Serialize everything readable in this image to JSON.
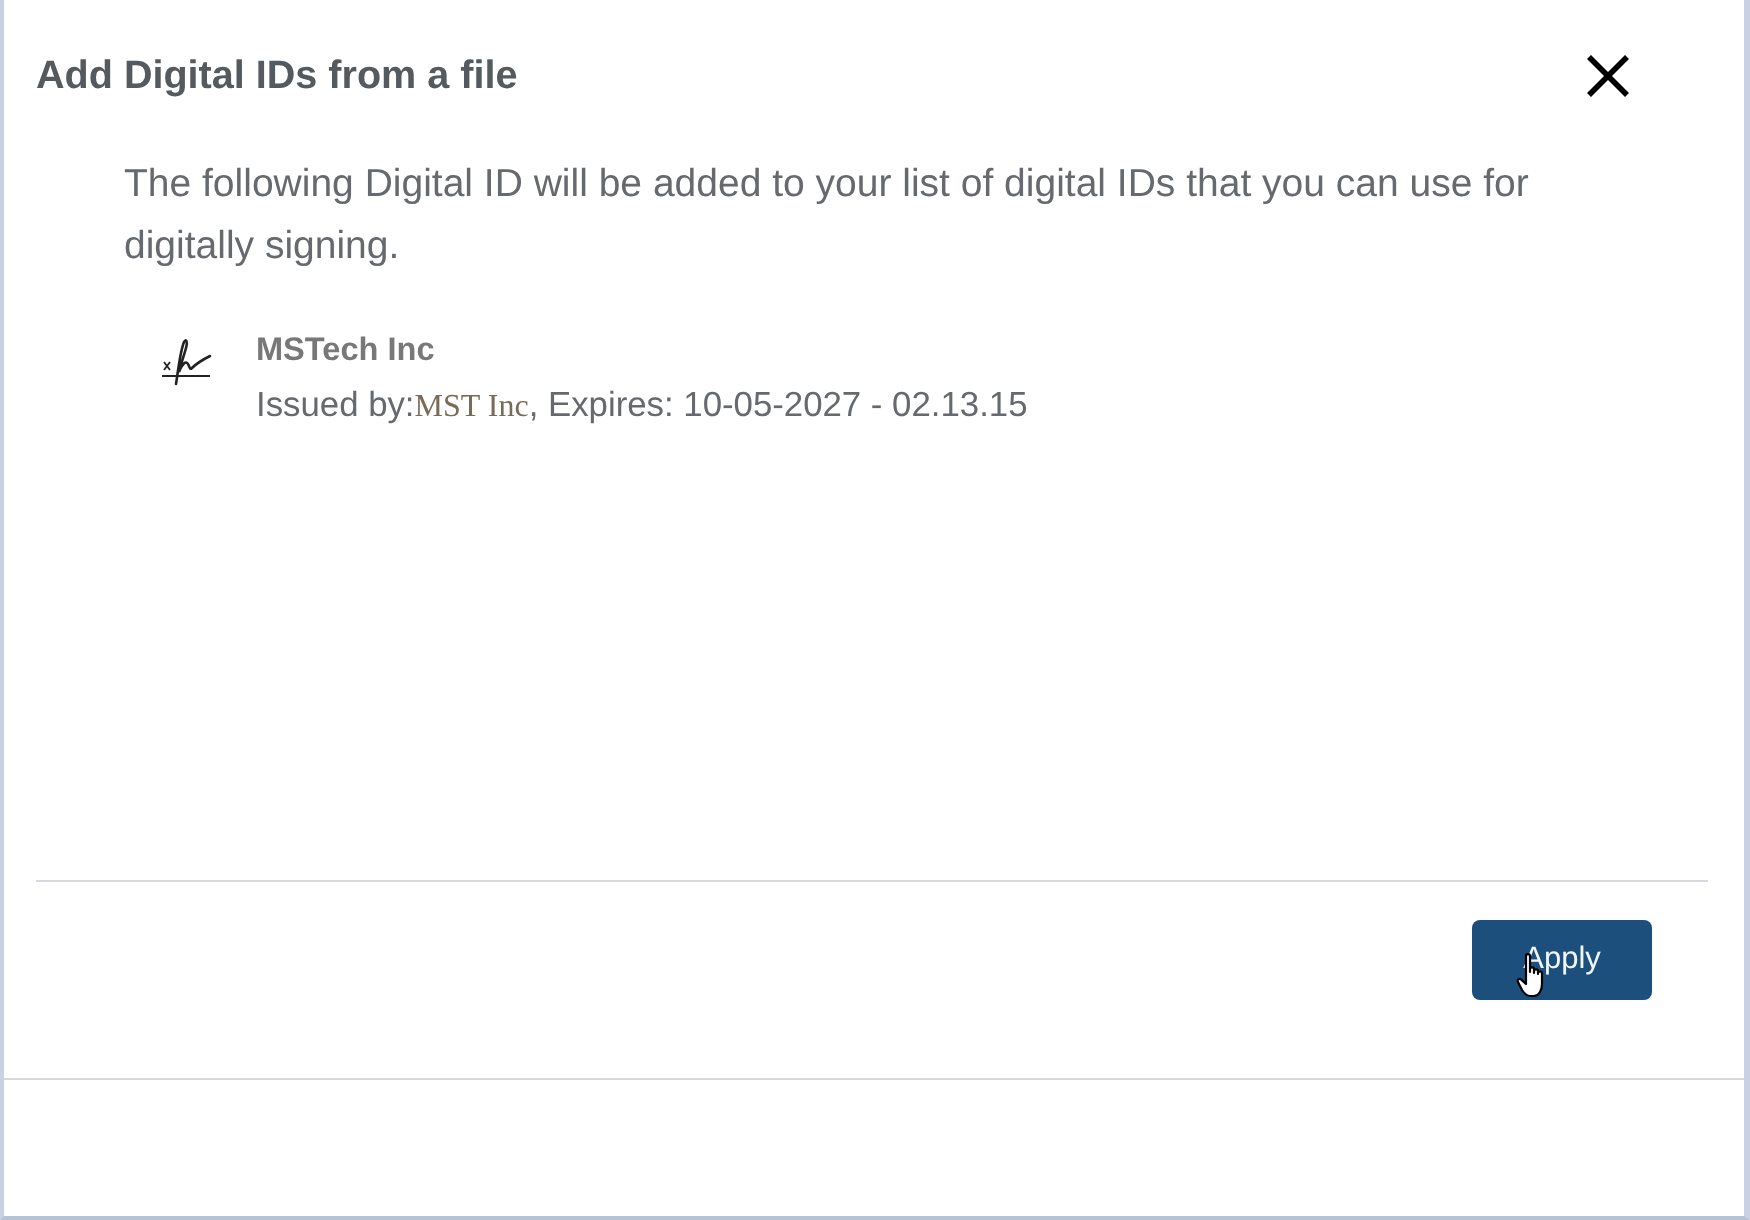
{
  "dialog": {
    "title": "Add Digital IDs from a file",
    "message": "The following Digital ID will be added to your list of digital IDs that you can use for digitally signing."
  },
  "digital_id": {
    "name": "MSTech Inc",
    "issued_by_label": "Issued by:",
    "issuer": "MST Inc",
    "expiry": ", Expires: 10-05-2027 - 02.13.15"
  },
  "buttons": [
    {
      "label": "Apply",
      "kind": "primary"
    }
  ]
}
